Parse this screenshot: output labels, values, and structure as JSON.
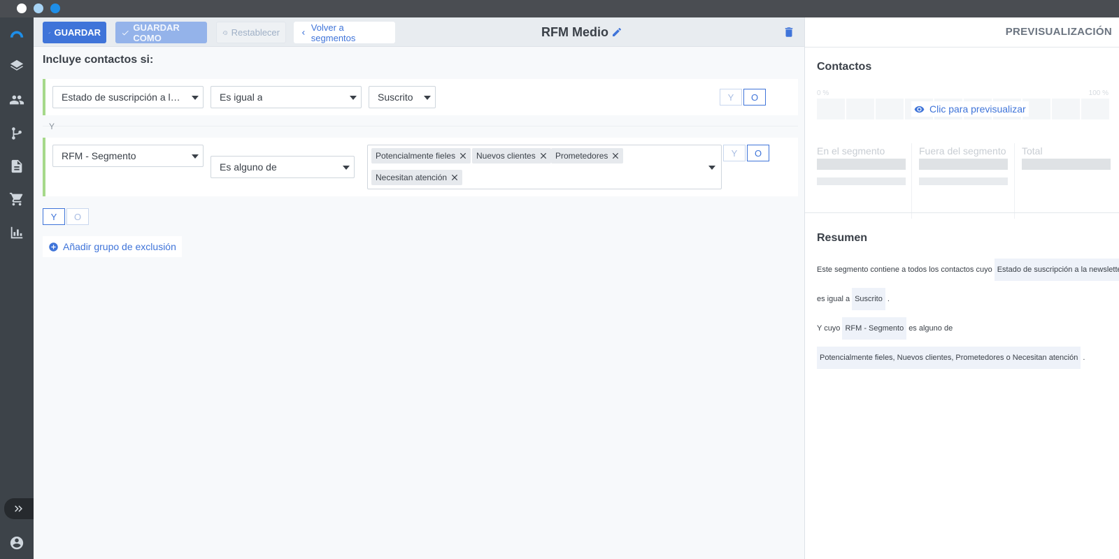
{
  "toolbar": {
    "save_label": "GUARDAR",
    "save_as_label": "GUARDAR COMO",
    "reset_label": "Restablecer",
    "back_label": "Volver a segmentos",
    "segment_name": "RFM Medio"
  },
  "builder": {
    "heading": "Incluye contactos si:",
    "row1": {
      "field": "Estado de suscripción a la ne...",
      "operator": "Es igual a",
      "value": "Suscrito"
    },
    "separator": "Y",
    "row2": {
      "field": "RFM - Segmento",
      "operator": "Es alguno de",
      "tags": [
        "Potencialmente fieles",
        "Nuevos clientes",
        "Prometedores",
        "Necesitan atención"
      ]
    },
    "and_label": "Y",
    "or_label": "O",
    "add_exclusion": "Añadir grupo de exclusión"
  },
  "preview": {
    "title": "PREVISUALIZACIÓN",
    "contacts_heading": "Contactos",
    "pct_min": "0 %",
    "pct_max": "100 %",
    "click_preview": "Clic para previsualizar",
    "in_segment": "En el segmento",
    "out_segment": "Fuera del segmento",
    "total": "Total"
  },
  "summary": {
    "heading": "Resumen",
    "l1_text": "Este segmento contiene a todos los contactos cuyo",
    "l1_chip": "Estado de suscripción a la newsletter",
    "l2_text": "es igual a",
    "l2_chip": "Suscrito",
    "l2_end": ".",
    "l3_text": "Y cuyo",
    "l3_chip": "RFM - Segmento",
    "l3_end": "es alguno de",
    "l4_chip": "Potencialmente fieles, Nuevos clientes, Prometedores o Necesitan atención",
    "l4_end": "."
  },
  "colors": {
    "accent": "#3f74d9",
    "nav_bg": "#3d4349",
    "condition_border": "#a6d98a"
  }
}
